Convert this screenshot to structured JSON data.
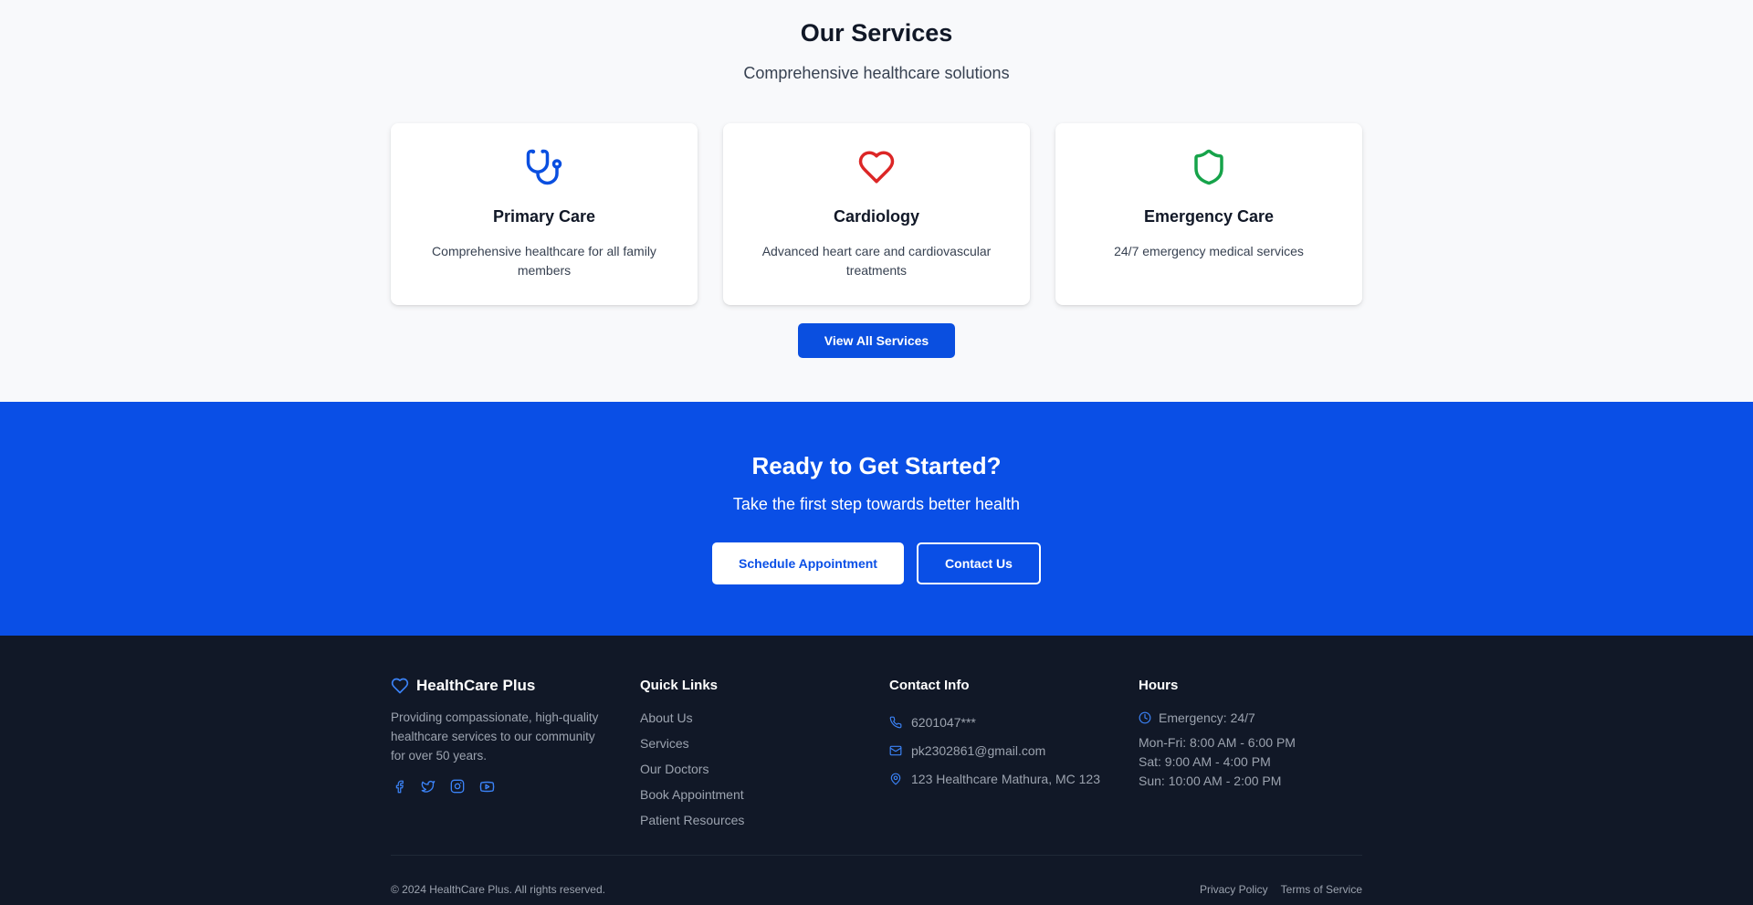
{
  "services": {
    "title": "Our Services",
    "subtitle": "Comprehensive healthcare solutions",
    "cards": [
      {
        "title": "Primary Care",
        "description": "Comprehensive healthcare for all family members",
        "icon": "stethoscope-icon",
        "color": "#0a4fe0"
      },
      {
        "title": "Cardiology",
        "description": "Advanced heart care and cardiovascular treatments",
        "icon": "heart-icon",
        "color": "#dc2626"
      },
      {
        "title": "Emergency Care",
        "description": "24/7 emergency medical services",
        "icon": "shield-icon",
        "color": "#16a34a"
      }
    ],
    "view_all_label": "View All Services"
  },
  "cta": {
    "title": "Ready to Get Started?",
    "subtitle": "Take the first step towards better health",
    "schedule_label": "Schedule Appointment",
    "contact_label": "Contact Us"
  },
  "footer": {
    "brand": "HealthCare Plus",
    "about": "Providing compassionate, high-quality healthcare services to our community for over 50 years.",
    "social_icons": [
      "facebook-icon",
      "twitter-icon",
      "instagram-icon",
      "youtube-icon"
    ],
    "quick_links_heading": "Quick Links",
    "quick_links": [
      "About Us",
      "Services",
      "Our Doctors",
      "Book Appointment",
      "Patient Resources"
    ],
    "contact_heading": "Contact Info",
    "phone": "6201047***",
    "email": "pk2302861@gmail.com",
    "address": "123 Healthcare Mathura, MC 123",
    "hours_heading": "Hours",
    "emergency": "Emergency: 24/7",
    "hours": [
      "Mon-Fri: 8:00 AM - 6:00 PM",
      "Sat: 9:00 AM - 4:00 PM",
      "Sun: 10:00 AM - 2:00 PM"
    ],
    "copyright": "© 2024 HealthCare Plus. All rights reserved.",
    "privacy_label": "Privacy Policy",
    "terms_label": "Terms of Service"
  },
  "colors": {
    "primary": "#0a4fe6",
    "footer_bg": "#111827",
    "accent_icon": "#3b82f6"
  }
}
